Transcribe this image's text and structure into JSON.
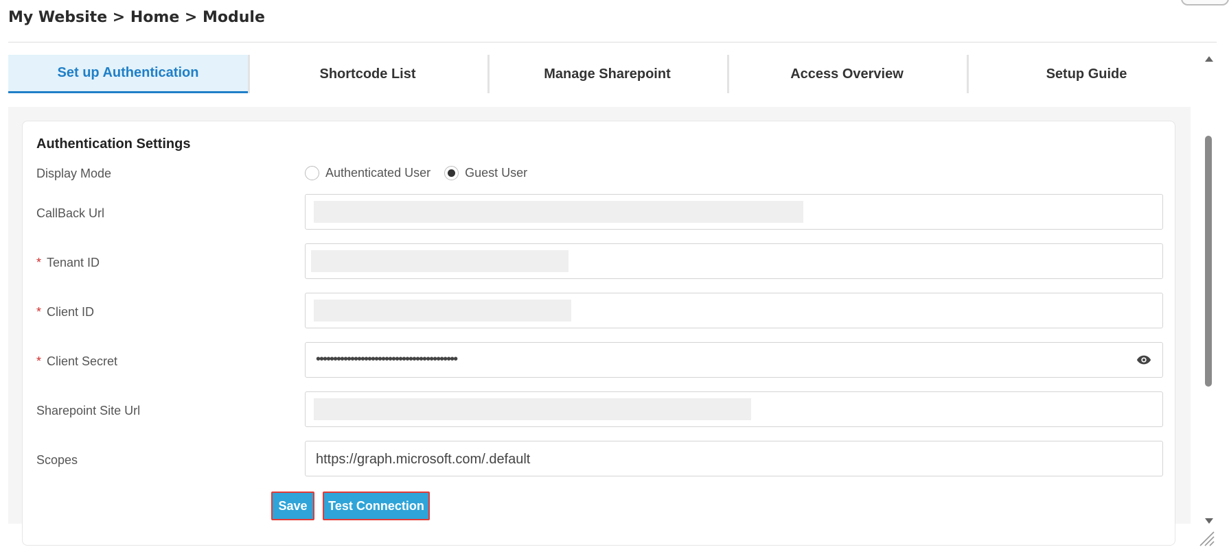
{
  "breadcrumb": "My Website > Home > Module",
  "tabs": [
    {
      "label": "Set up Authentication",
      "active": true
    },
    {
      "label": "Shortcode List",
      "active": false
    },
    {
      "label": "Manage Sharepoint",
      "active": false
    },
    {
      "label": "Access Overview",
      "active": false
    },
    {
      "label": "Setup Guide",
      "active": false
    }
  ],
  "settings": {
    "title": "Authentication Settings",
    "display_mode": {
      "label": "Display Mode",
      "options": [
        "Authenticated User",
        "Guest User"
      ],
      "selected": "Guest User"
    },
    "callback_url": {
      "label": "CallBack Url",
      "value": ""
    },
    "tenant_id": {
      "label": "Tenant ID",
      "required_mark": "*",
      "value": ""
    },
    "client_id": {
      "label": "Client ID",
      "required_mark": "*",
      "value": ""
    },
    "client_secret": {
      "label": "Client Secret",
      "required_mark": "*",
      "masked_value": "•••••••••••••••••••••••••••••••••••••••••"
    },
    "sharepoint_site_url": {
      "label": "Sharepoint Site Url",
      "value": ""
    },
    "scopes": {
      "label": "Scopes",
      "value": "https://graph.microsoft.com/.default"
    }
  },
  "buttons": {
    "save": "Save",
    "test_connection": "Test Connection"
  },
  "colors": {
    "accent": "#1f7fc7",
    "active_tab_bg": "#e3f2fb",
    "button_bg": "#2fa4d8",
    "button_outline": "#e53935",
    "required": "#d32f2f"
  },
  "icons": {
    "password_toggle": "eye-icon"
  }
}
